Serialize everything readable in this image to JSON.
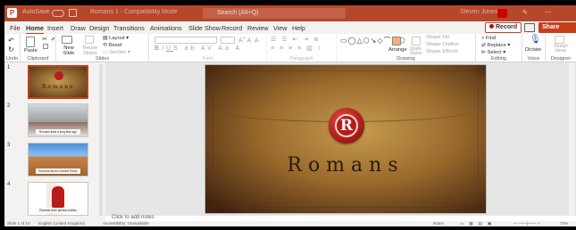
{
  "titlebar": {
    "app_logo": "P",
    "autosave": "AutoSave",
    "title": "Romans 1 - Compatibility Mode",
    "search_placeholder": "Search (Alt+Q)",
    "user": "Steven Jones",
    "pen": "✎",
    "minimize": "—"
  },
  "tabs": [
    "File",
    "Home",
    "Insert",
    "Draw",
    "Design",
    "Transitions",
    "Animations",
    "Slide Show",
    "Record",
    "Review",
    "View",
    "Help"
  ],
  "active_tab": "Home",
  "header_buttons": {
    "record": "Record",
    "share": "Share"
  },
  "ribbon": {
    "groups": {
      "undo": "Undo",
      "clipboard": "Clipboard",
      "slides": "Slides",
      "font": "Font",
      "paragraph": "Paragraph",
      "drawing": "Drawing",
      "editing": "Editing",
      "voice": "Voice",
      "designer": "Designer"
    },
    "paste": "Paste",
    "new_slide": "New Slide",
    "reuse_slides": "Reuse Slides",
    "layout": "Layout",
    "reset": "Reset",
    "section": "Section",
    "arrange": "Arrange",
    "quick_styles": "Quick Styles",
    "shape_fill": "Shape Fill",
    "shape_outline": "Shape Outline",
    "shape_effects": "Shape Effects",
    "find": "Find",
    "replace": "Replace",
    "select": "Select",
    "dictate": "Dictate",
    "designer_btn": "Design Ideas"
  },
  "slides": [
    {
      "number": "1",
      "caption": "Romans",
      "selected": true
    },
    {
      "number": "2",
      "caption": "Romans lived a long time ago",
      "selected": false
    },
    {
      "number": "3",
      "caption": "Romans lived in Ancient Rome",
      "selected": false
    },
    {
      "number": "4",
      "caption": "Romans wore special clothes",
      "selected": false
    },
    {
      "number": "5",
      "caption": "",
      "selected": false
    }
  ],
  "slide": {
    "seal_letter": "R",
    "title": "Romans"
  },
  "notes_placeholder": "Click to add notes",
  "status": {
    "slide_of": "Slide 1 of 10",
    "language": "English (United Kingdom)",
    "accessibility": "Accessibility: Unavailable",
    "notes": "Notes",
    "zoom": "74%"
  },
  "colors": {
    "accent": "#b7472a",
    "share": "#c43e1c",
    "seal": "#b71c1c"
  }
}
